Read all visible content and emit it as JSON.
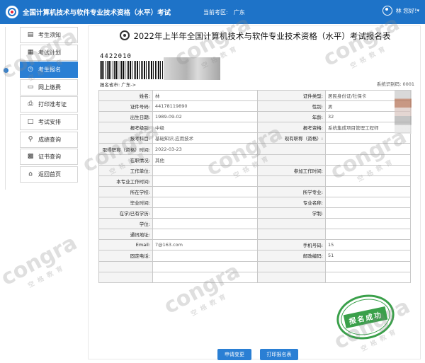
{
  "header": {
    "app_title": "全国计算机技术与软件专业技术资格（水平）考试",
    "region_label": "当前考区:",
    "region_value": "广东",
    "user_greeting": "林 您好!",
    "user_menu_icon": "chevron-down-icon"
  },
  "sidebar": {
    "items": [
      {
        "label": "考生须知",
        "icon": "document-icon",
        "active": false
      },
      {
        "label": "考试计划",
        "icon": "calendar-icon",
        "active": false
      },
      {
        "label": "考生报名",
        "icon": "clock-icon",
        "active": true
      },
      {
        "label": "网上缴费",
        "icon": "monitor-icon",
        "active": false
      },
      {
        "label": "打印准考证",
        "icon": "printer-icon",
        "active": false
      },
      {
        "label": "考试安排",
        "icon": "chat-icon",
        "active": false
      },
      {
        "label": "成绩查询",
        "icon": "search-icon",
        "active": false
      },
      {
        "label": "证书查询",
        "icon": "certificate-icon",
        "active": false
      },
      {
        "label": "返回首页",
        "icon": "home-icon",
        "active": false
      }
    ]
  },
  "form": {
    "title": "2022年上半年全国计算机技术与软件专业技术资格（水平）考试报名表",
    "barcode_number": "4422010",
    "submit_region": "报名省市: 广东->",
    "serial_label": "系统识别码: 0001",
    "rows": [
      {
        "l1": "姓名:",
        "v1": "林",
        "l2": "证件类型:",
        "v2": "居民身份证/社保卡"
      },
      {
        "l1": "证件号码:",
        "v1": "44178119890",
        "l2": "性别:",
        "v2": "男"
      },
      {
        "l1": "出生日期:",
        "v1": "1989-09-02",
        "l2": "年龄:",
        "v2": "32"
      },
      {
        "l1": "报考级别:",
        "v1": "中级",
        "l2": "报考资格:",
        "v2": "系统集成项目管理工程师"
      },
      {
        "l1": "报考科目:",
        "v1": "基础知识,应用技术",
        "l2": "现有职称（资格）:",
        "v2": ""
      },
      {
        "l1": "取得职称（资格）时间:",
        "v1": "2022-03-23",
        "l2": "",
        "v2": ""
      },
      {
        "l1": "在职情况:",
        "v1": "其他",
        "l2": "",
        "v2": ""
      },
      {
        "l1": "工作单位:",
        "v1": "",
        "l2": "参加工作时间:",
        "v2": ""
      },
      {
        "l1": "本专业工作时间:",
        "v1": "",
        "l2": "",
        "v2": ""
      },
      {
        "l1": "所在学校:",
        "v1": "",
        "l2": "所学专业:",
        "v2": ""
      },
      {
        "l1": "毕业时间:",
        "v1": "",
        "l2": "专业名称:",
        "v2": ""
      },
      {
        "l1": "在学/已有学历:",
        "v1": "",
        "l2": "学制:",
        "v2": ""
      },
      {
        "l1": "学位:",
        "v1": "",
        "l2": "",
        "v2": ""
      },
      {
        "l1": "通讯地址:",
        "v1": "",
        "l2": "",
        "v2": ""
      },
      {
        "l1": "Email:",
        "v1": "7@163.com",
        "l2": "手机号码:",
        "v2": "15"
      },
      {
        "l1": "固定电话:",
        "v1": "",
        "l2": "邮政编码:",
        "v2": "51"
      },
      {
        "l1": "",
        "v1": "",
        "l2": "",
        "v2": ""
      },
      {
        "l1": "",
        "v1": "",
        "l2": "",
        "v2": ""
      }
    ],
    "stamp_text": "报名成功"
  },
  "actions": {
    "change_label": "申请变更",
    "print_label": "打印报名表"
  },
  "watermark": {
    "text": "congra",
    "sub": "空格教育"
  },
  "colors": {
    "primary": "#1e73c8",
    "active": "#2a7fd4",
    "stamp": "#3aa04a"
  }
}
